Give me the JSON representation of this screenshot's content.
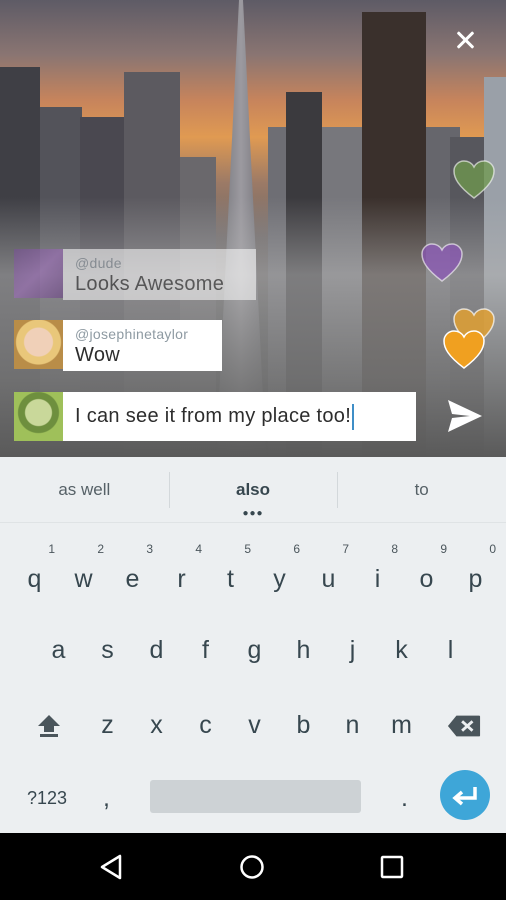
{
  "chat": {
    "messages": [
      {
        "user": "@dude",
        "text": "Looks Awesome"
      },
      {
        "user": "@josephinetaylor",
        "text": "Wow"
      }
    ],
    "composer_text": "I can see it from my place too!"
  },
  "hearts": [
    {
      "color": "#6f9a4e"
    },
    {
      "color": "#8a55b4"
    },
    {
      "color": "#e0a032"
    },
    {
      "color": "#f0a020"
    }
  ],
  "keyboard": {
    "suggestions": [
      "as well",
      "also",
      "to"
    ],
    "row1": [
      {
        "key": "q",
        "hint": "1"
      },
      {
        "key": "w",
        "hint": "2"
      },
      {
        "key": "e",
        "hint": "3"
      },
      {
        "key": "r",
        "hint": "4"
      },
      {
        "key": "t",
        "hint": "5"
      },
      {
        "key": "y",
        "hint": "6"
      },
      {
        "key": "u",
        "hint": "7"
      },
      {
        "key": "i",
        "hint": "8"
      },
      {
        "key": "o",
        "hint": "9"
      },
      {
        "key": "p",
        "hint": "0"
      }
    ],
    "row2": [
      "a",
      "s",
      "d",
      "f",
      "g",
      "h",
      "j",
      "k",
      "l"
    ],
    "row3": [
      "z",
      "x",
      "c",
      "v",
      "b",
      "n",
      "m"
    ],
    "symbols_label": "?123",
    "comma": ",",
    "period": "."
  },
  "colors": {
    "accent": "#3ea6d8",
    "keyboard_bg": "#eceff1",
    "key_text": "#37474f"
  }
}
